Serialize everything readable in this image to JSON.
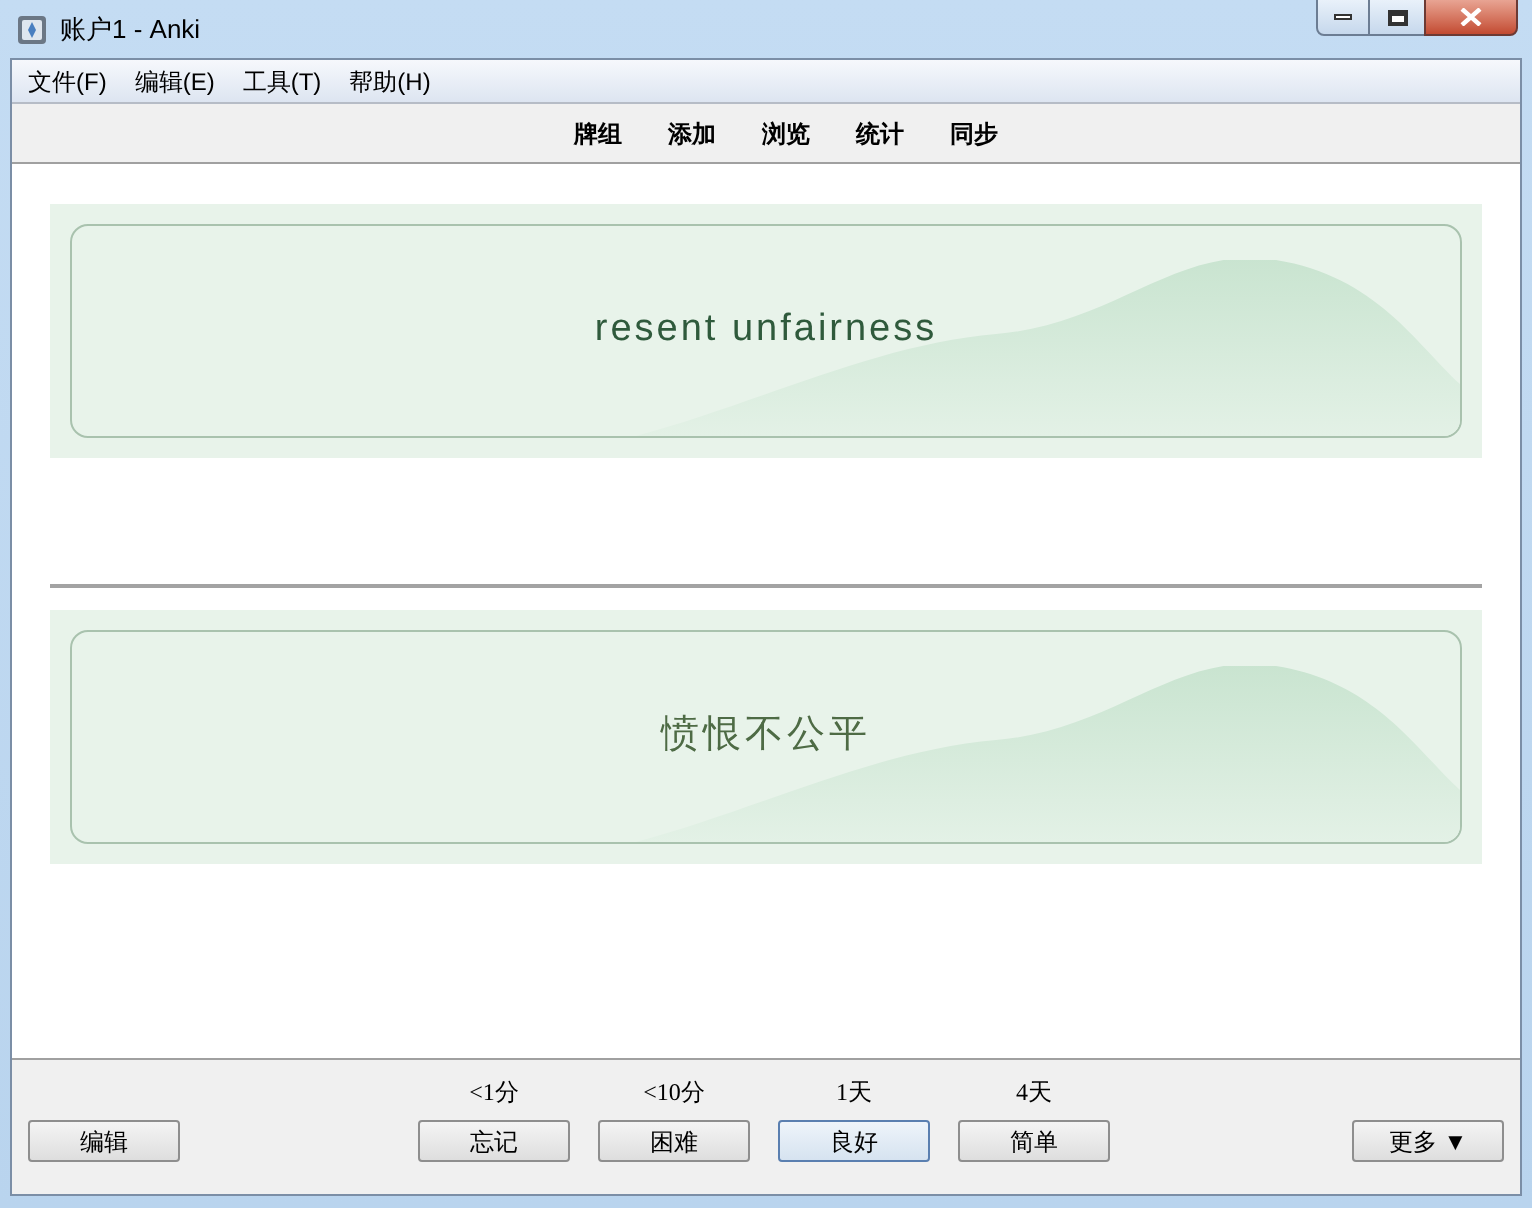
{
  "window": {
    "title": "账户1 - Anki"
  },
  "menu": [
    "文件(F)",
    "编辑(E)",
    "工具(T)",
    "帮助(H)"
  ],
  "toolbar": [
    "牌组",
    "添加",
    "浏览",
    "统计",
    "同步"
  ],
  "cards": [
    {
      "kind": "front",
      "text": "resent unfairness"
    },
    {
      "kind": "back",
      "text": "愤恨不公平"
    }
  ],
  "bottom_bar": {
    "edit_button": "编辑",
    "answers": [
      {
        "interval": "<1分",
        "label": "忘记",
        "default": false
      },
      {
        "interval": "<10分",
        "label": "困难",
        "default": false
      },
      {
        "interval": "1天",
        "label": "良好",
        "default": true
      },
      {
        "interval": "4天",
        "label": "简单",
        "default": false
      }
    ],
    "more_button": "更多 ▼"
  }
}
